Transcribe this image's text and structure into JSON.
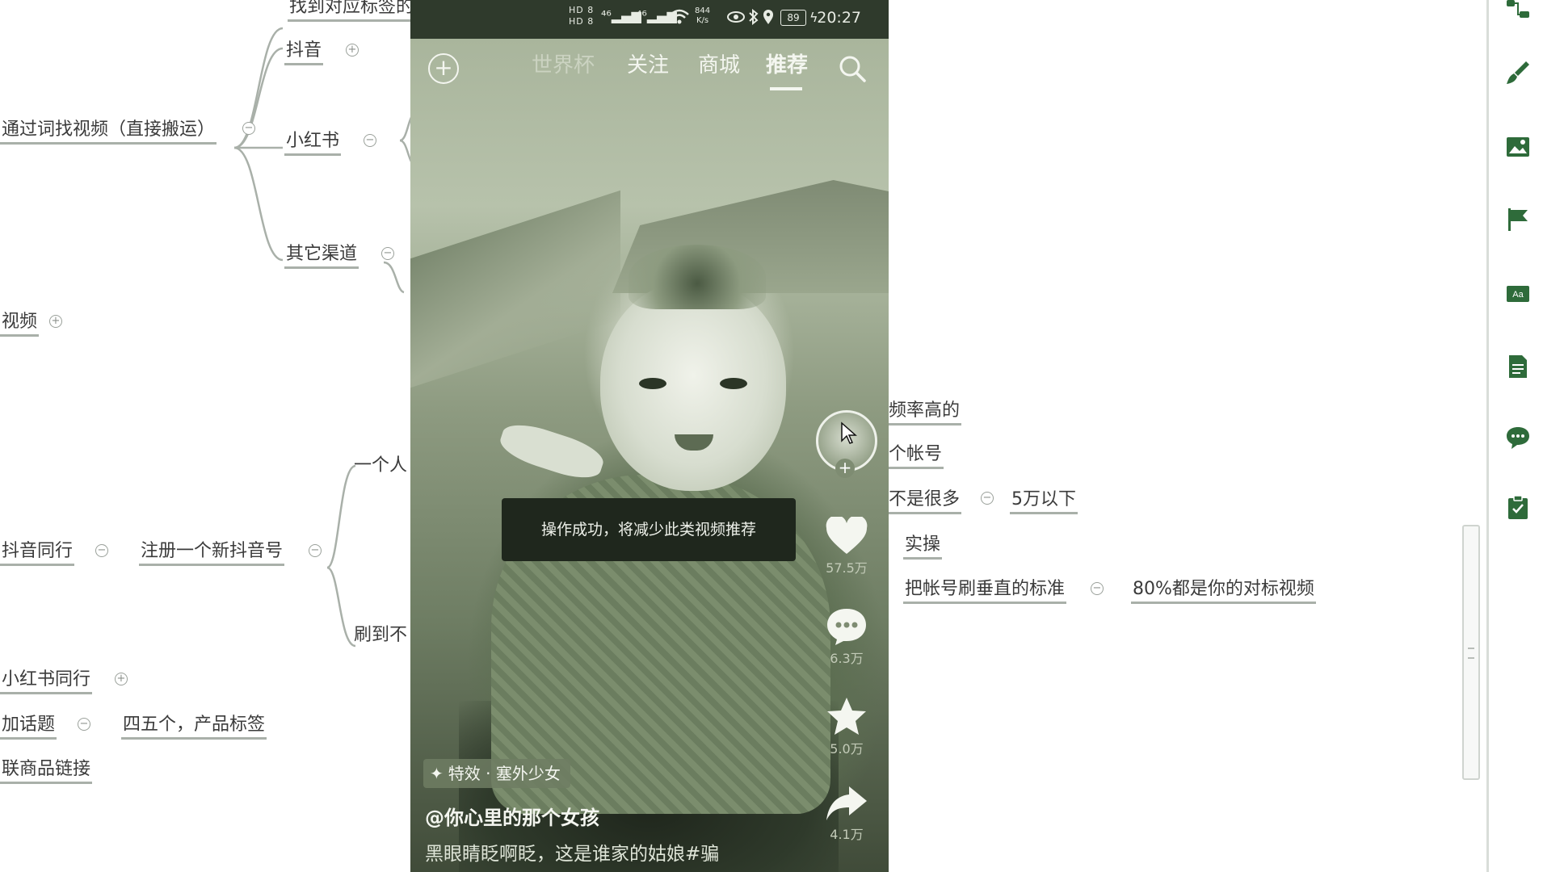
{
  "mindmap": {
    "nodes": {
      "find_tag_video": "找到对应标签的",
      "douyin": "抖音",
      "via_words": "通过词找视频（直接搬运）",
      "xiaohongshu": "小红书",
      "other_channels": "其它渠道",
      "video": "视频",
      "one_person": "一个人",
      "douyin_peers": "抖音同行",
      "register_new": "注册一个新抖音号",
      "scroll_to": "刷到不",
      "xhs_peers": "小红书同行",
      "add_topics": "加话题",
      "four_five_tags": "四五个，产品标签",
      "link_product": "联商品链接",
      "high_freq": "频率高的",
      "one_account": "个帐号",
      "not_many": "不是很多",
      "under_50k": "5万以下",
      "practice": "实操",
      "brush_account": "把帐号刷垂直的标准",
      "eighty_percent": "80%都是你的对标视频"
    },
    "toggles": {
      "expand": "+",
      "collapse": "−"
    }
  },
  "phone": {
    "status": {
      "hd_labels": "HD 8\nHD 8",
      "signal_1": "⁴⁶▂▄▆",
      "signal_2": "⁴⁶▂▄▆",
      "speed": "844\nK/s",
      "battery": "89",
      "time": "20:27"
    },
    "nav": {
      "tabs": [
        "世界杯",
        "关注",
        "商城",
        "推荐"
      ],
      "active_tab": "推荐"
    },
    "sidebar": {
      "likes": "57.5万",
      "comments": "6.3万",
      "favorites": "5.0万",
      "shares": "4.1万"
    },
    "toast": "操作成功，将减少此类视频推荐",
    "effect": "特效 · 塞外少女",
    "author": "@你心里的那个女孩",
    "description": "黑眼睛眨啊眨，这是谁家的姑娘#骗"
  },
  "colors": {
    "tint": "#8f9c82",
    "status_bar": "#2f3a2c",
    "toast_bg": "#1f271d",
    "mindmap_line": "#a9b0a9"
  },
  "toolbar": {
    "icons": [
      "nodes-icon",
      "brush-icon",
      "image-icon",
      "flag-icon",
      "text-style-icon",
      "note-icon",
      "comment-icon",
      "clipboard-icon"
    ]
  }
}
